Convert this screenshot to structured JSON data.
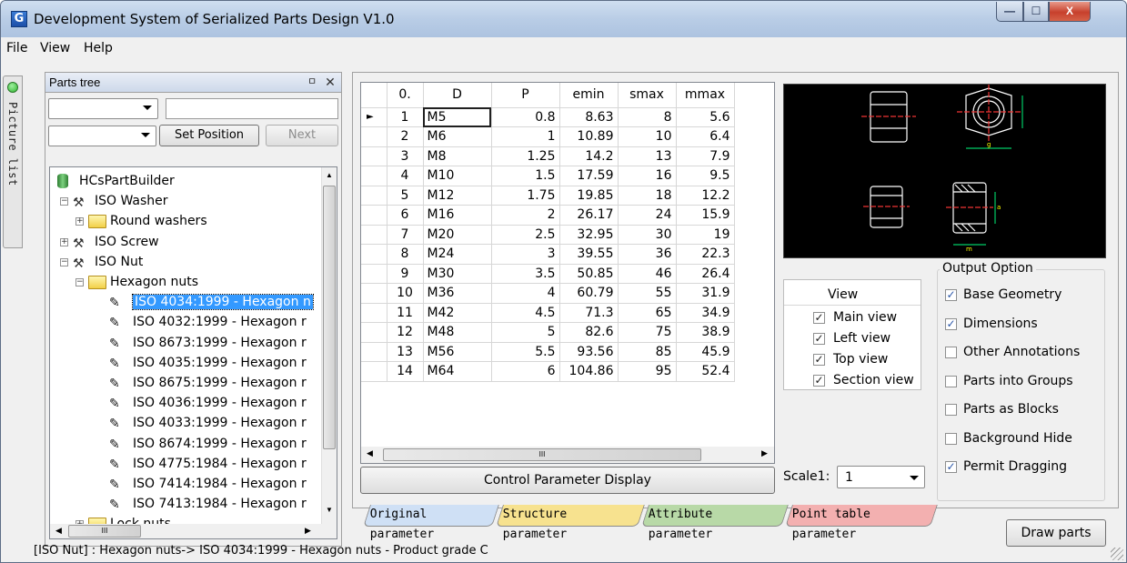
{
  "window": {
    "title": "Development System of Serialized Parts Design V1.0",
    "app_icon_glyph": "G",
    "min_glyph": "—",
    "max_glyph": "☐",
    "close_glyph": "X"
  },
  "menubar": [
    "File",
    "View",
    "Help"
  ],
  "side_tab": {
    "label": "Picture list"
  },
  "parts_tree": {
    "title": "Parts tree",
    "pin_glyph": "ㅁ",
    "close_glyph": "✕",
    "search_value": "",
    "set_position_label": "Set Position",
    "next_label": "Next",
    "nodes": [
      {
        "label": "HCsPartBuilder",
        "icon": "database-icon",
        "level": 0,
        "expander": ""
      },
      {
        "label": "ISO Washer",
        "icon": "tool-icon",
        "level": 1,
        "expander": "−"
      },
      {
        "label": "Round washers",
        "icon": "folder-icon",
        "level": 2,
        "expander": "+"
      },
      {
        "label": "ISO Screw",
        "icon": "tool-icon",
        "level": 1,
        "expander": "+"
      },
      {
        "label": "ISO Nut",
        "icon": "tool-icon",
        "level": 1,
        "expander": "−"
      },
      {
        "label": "Hexagon nuts",
        "icon": "folder-icon",
        "level": 2,
        "expander": "−"
      },
      {
        "label": "ISO 4034:1999 - Hexagon n",
        "icon": "part-icon",
        "level": 3,
        "selected": true
      },
      {
        "label": "ISO 4032:1999 - Hexagon r",
        "icon": "part-icon",
        "level": 3
      },
      {
        "label": "ISO 8673:1999 - Hexagon r",
        "icon": "part-icon",
        "level": 3
      },
      {
        "label": "ISO 4035:1999 - Hexagon r",
        "icon": "part-icon",
        "level": 3
      },
      {
        "label": "ISO 8675:1999 - Hexagon r",
        "icon": "part-icon",
        "level": 3
      },
      {
        "label": "ISO 4036:1999 - Hexagon r",
        "icon": "part-icon",
        "level": 3
      },
      {
        "label": "ISO 4033:1999 - Hexagon r",
        "icon": "part-icon",
        "level": 3
      },
      {
        "label": "ISO 8674:1999 - Hexagon r",
        "icon": "part-icon",
        "level": 3
      },
      {
        "label": "ISO 4775:1984 - Hexagon r",
        "icon": "part-icon",
        "level": 3
      },
      {
        "label": "ISO 7414:1984 - Hexagon r",
        "icon": "part-icon",
        "level": 3
      },
      {
        "label": "ISO 7413:1984 - Hexagon r",
        "icon": "part-icon",
        "level": 3
      },
      {
        "label": "Lock nuts",
        "icon": "folder-icon",
        "level": 2,
        "expander": "+"
      }
    ]
  },
  "grid": {
    "columns": [
      "0.",
      "D",
      "P",
      "emin",
      "smax",
      "mmax"
    ],
    "rows": [
      [
        "1",
        "M5",
        "0.8",
        "8.63",
        "8",
        "5.6"
      ],
      [
        "2",
        "M6",
        "1",
        "10.89",
        "10",
        "6.4"
      ],
      [
        "3",
        "M8",
        "1.25",
        "14.2",
        "13",
        "7.9"
      ],
      [
        "4",
        "M10",
        "1.5",
        "17.59",
        "16",
        "9.5"
      ],
      [
        "5",
        "M12",
        "1.75",
        "19.85",
        "18",
        "12.2"
      ],
      [
        "6",
        "M16",
        "2",
        "26.17",
        "24",
        "15.9"
      ],
      [
        "7",
        "M20",
        "2.5",
        "32.95",
        "30",
        "19"
      ],
      [
        "8",
        "M24",
        "3",
        "39.55",
        "36",
        "22.3"
      ],
      [
        "9",
        "M30",
        "3.5",
        "50.85",
        "46",
        "26.4"
      ],
      [
        "10",
        "M36",
        "4",
        "60.79",
        "55",
        "31.9"
      ],
      [
        "11",
        "M42",
        "4.5",
        "71.3",
        "65",
        "34.9"
      ],
      [
        "12",
        "M48",
        "5",
        "82.6",
        "75",
        "38.9"
      ],
      [
        "13",
        "M56",
        "5.5",
        "93.56",
        "85",
        "45.9"
      ],
      [
        "14",
        "M64",
        "6",
        "104.86",
        "95",
        "52.4"
      ]
    ],
    "current_row_marker": "►",
    "scroll_grip": "III"
  },
  "control_param_button": "Control Parameter Display",
  "view_list": {
    "header": "View",
    "check_glyph": "✓",
    "items": [
      {
        "label": "Main view",
        "checked": true
      },
      {
        "label": "Left view",
        "checked": true
      },
      {
        "label": "Top view",
        "checked": true
      },
      {
        "label": "Section view",
        "checked": true
      }
    ]
  },
  "scale": {
    "label": "Scale1:",
    "value": "1"
  },
  "output_option": {
    "title": "Output Option",
    "check_glyph": "✓",
    "items": [
      {
        "label": "Base Geometry",
        "checked": true
      },
      {
        "label": "Dimensions",
        "checked": true
      },
      {
        "label": "Other Annotations",
        "checked": false
      },
      {
        "label": "Parts into Groups",
        "checked": false
      },
      {
        "label": "Parts as Blocks",
        "checked": false
      },
      {
        "label": "Background Hide",
        "checked": false
      },
      {
        "label": "Permit Dragging",
        "checked": true
      }
    ]
  },
  "preview": {
    "dim_g": "g",
    "dim_m": "m",
    "dim_a": "a"
  },
  "tabs": [
    {
      "label": "Original parameter",
      "color": "#cfe0f5"
    },
    {
      "label": "Structure parameter",
      "color": "#f7e28f"
    },
    {
      "label": "Attribute parameter",
      "color": "#b8d9a7"
    },
    {
      "label": "Point table parameter",
      "color": "#f3b0b0"
    }
  ],
  "draw_button": "Draw parts",
  "status": "[ISO Nut] : Hexagon nuts-> ISO 4034:1999 - Hexagon nuts - Product grade C",
  "tree_scroll_grip": "III"
}
